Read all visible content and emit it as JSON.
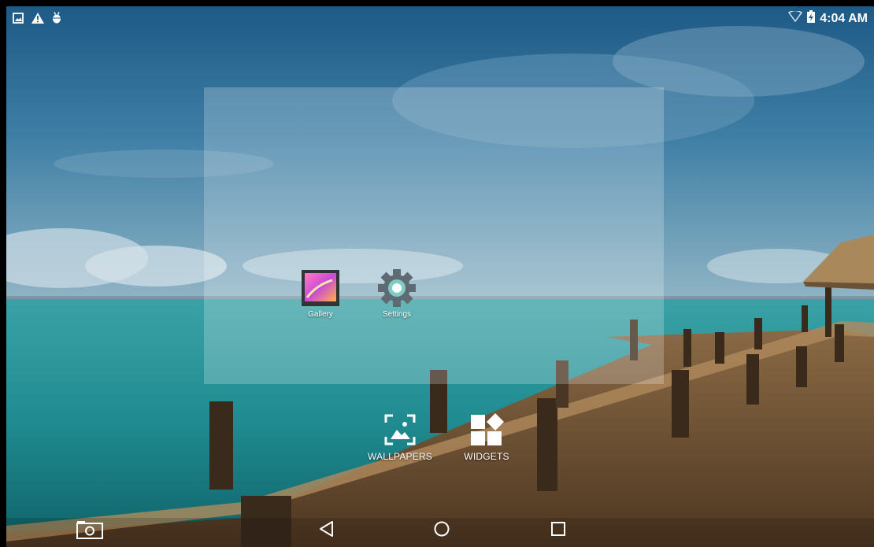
{
  "status_bar": {
    "left_icons": [
      "image-notification-icon",
      "warning-icon",
      "android-debug-icon"
    ],
    "right_icons": [
      "wifi-icon",
      "battery-charging-icon"
    ],
    "time": "4:04 AM"
  },
  "home_apps": [
    {
      "label": "Gallery",
      "icon": "gallery-icon"
    },
    {
      "label": "Settings",
      "icon": "settings-icon"
    }
  ],
  "overview_options": {
    "wallpapers_label": "WALLPAPERS",
    "widgets_label": "WIDGETS"
  },
  "nav_bar": {
    "buttons": [
      "screenshot-icon",
      "back-icon",
      "home-icon",
      "recents-icon"
    ]
  },
  "colors": {
    "settings_accent": "#80cbc4",
    "icon_white": "#ffffff"
  }
}
